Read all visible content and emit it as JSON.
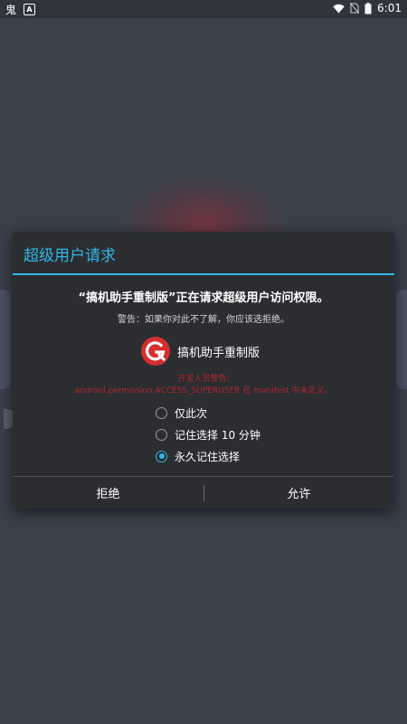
{
  "status_bar": {
    "notif_icon_a": "鬼",
    "notif_icon_b": "A",
    "time": "6:01"
  },
  "dialog": {
    "title": "超级用户请求",
    "heading": "“搞机助手重制版”正在请求超级用户访问权限。",
    "warning": "警告：如果你对此不了解，你应该选拒绝。",
    "app_name": "搞机助手重制版",
    "dev_warning_line1": "开发人员警告:",
    "dev_warning_line2": "android.permission.ACCESS_SUPERUSER 在 manifest 中未定义。",
    "options": [
      {
        "label": "仅此次",
        "checked": false
      },
      {
        "label": "记住选择 10 分钟",
        "checked": false
      },
      {
        "label": "永久记住选择",
        "checked": true
      }
    ],
    "deny_label": "拒绝",
    "allow_label": "允许"
  },
  "colors": {
    "accent": "#33b5e5",
    "dialog_bg": "#2b2d31",
    "screen_bg": "#3b414c",
    "dev_warning": "#b3262b",
    "app_icon": "#d32f2f"
  }
}
